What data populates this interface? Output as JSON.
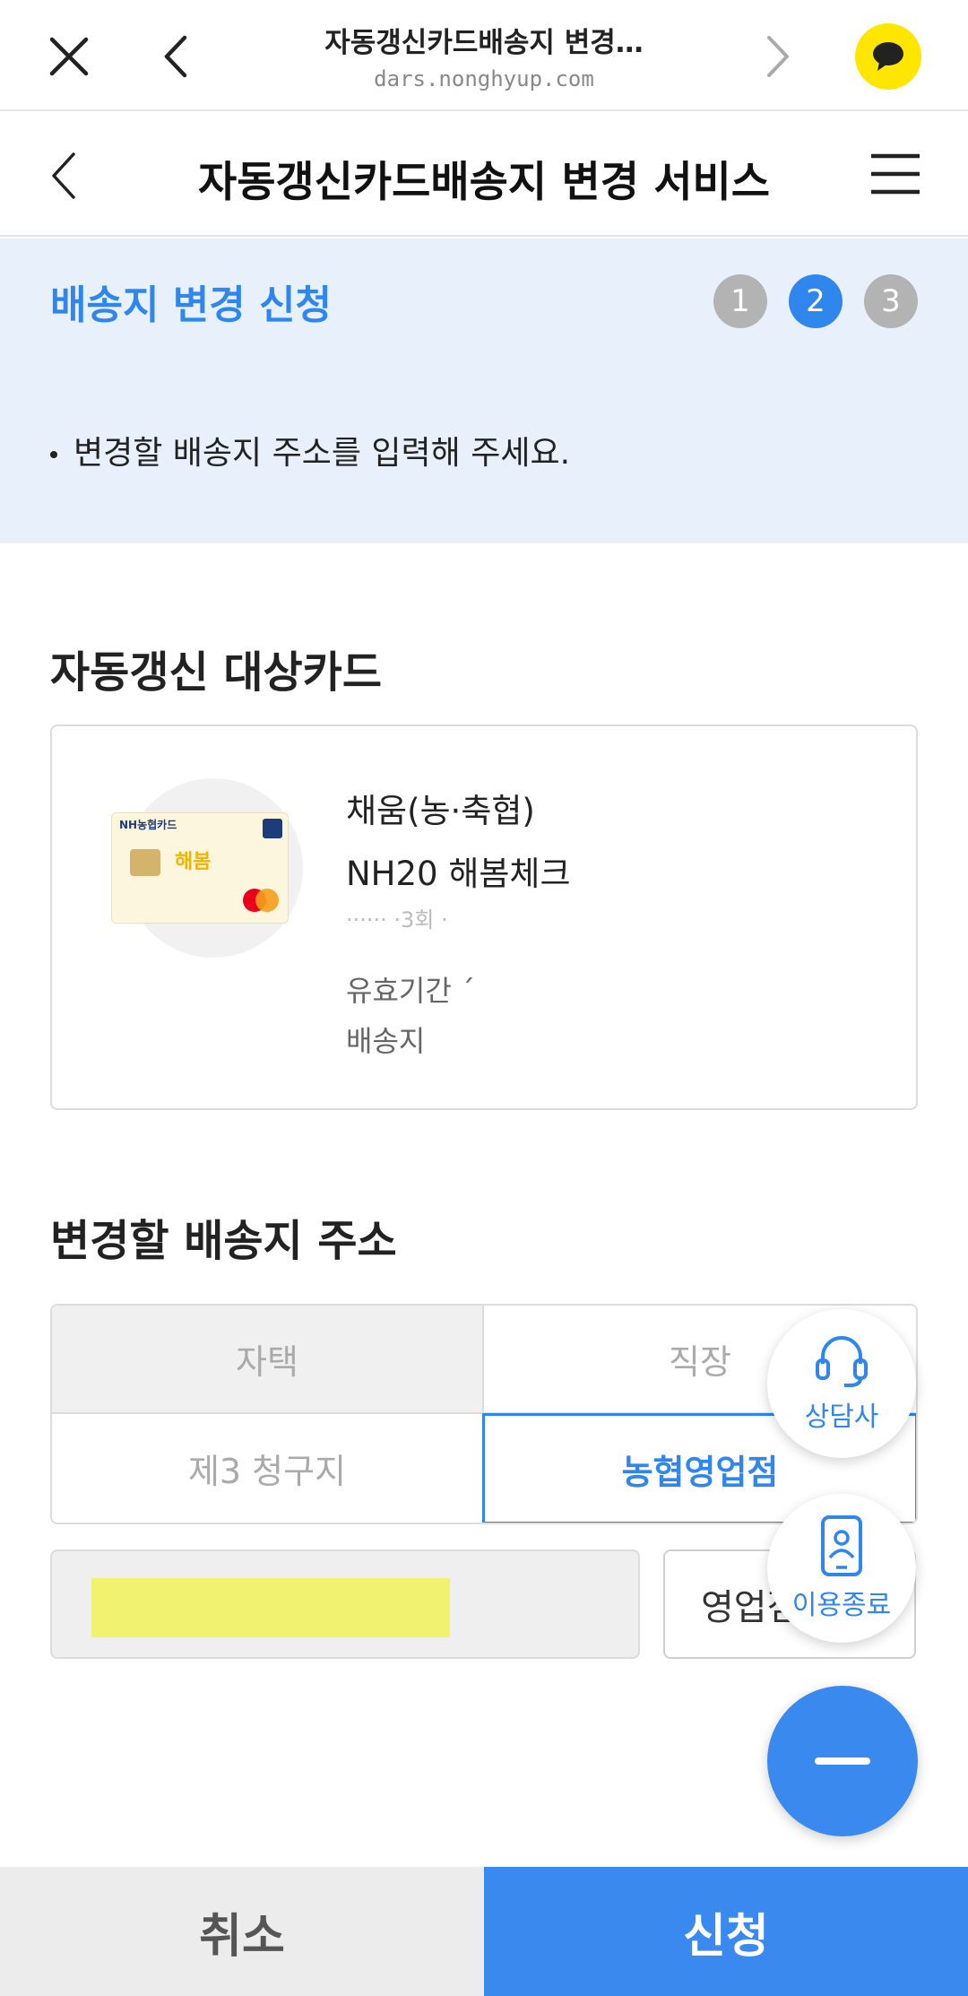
{
  "browser": {
    "title": "자동갱신카드배송지 변경…",
    "url": "dars.nonghyup.com"
  },
  "header": {
    "title": "자동갱신카드배송지 변경 서비스"
  },
  "step_banner": {
    "title": "배송지 변경 신청",
    "steps": [
      "1",
      "2",
      "3"
    ],
    "active_step": 2,
    "description": "변경할 배송지 주소를 입력해 주세요."
  },
  "target_card": {
    "heading": "자동갱신 대상카드",
    "card_image": {
      "brand": "NH농협카드",
      "product_mark": "해봄"
    },
    "name_line1": "채움(농·축협)",
    "name_line2": "NH20 해봄체크",
    "masked_line": "······ ·3회 ·",
    "expiry_label": "유효기간 ´",
    "delivery_label": "배송지"
  },
  "new_address": {
    "heading": "변경할 배송지 주소",
    "tabs": {
      "home": "자택",
      "work": "직장",
      "third": "제3 청구지",
      "branch": "농협영업점"
    },
    "selected_tab": "농협영업점",
    "branch_button": "영업점"
  },
  "floating": {
    "counselor": "상담사",
    "exit": "이용종료"
  },
  "bottom": {
    "cancel": "취소",
    "apply": "신청"
  },
  "colors": {
    "accent": "#2f86ec",
    "banner_bg": "#e8f0fb",
    "kakao": "#ffe600"
  }
}
